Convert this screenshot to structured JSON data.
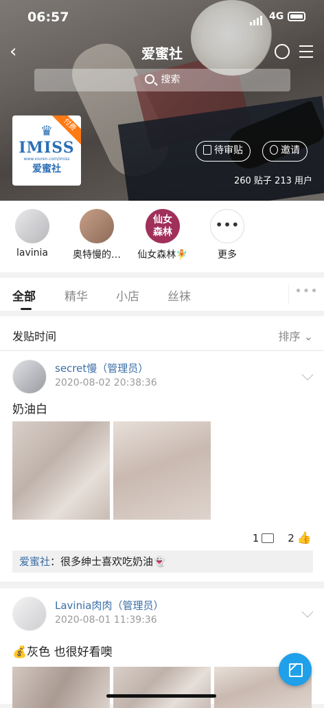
{
  "status_bar": {
    "time": "06:57",
    "network": "4G"
  },
  "header": {
    "title": "爱蜜社",
    "search_placeholder": "搜索"
  },
  "forum": {
    "logo_brand": "IMISS",
    "logo_url": "www.xiuren.com/imiss",
    "logo_cn": "爱蜜社",
    "paid_badge": "付费",
    "pending_label": "待审贴",
    "invite_label": "邀请",
    "stats": "260 贴子  213 用户"
  },
  "quick_links": [
    {
      "label": "lavinia"
    },
    {
      "label": "奥特慢的…"
    },
    {
      "label": "仙女森林🧚",
      "avatar_text": "仙女\n森林"
    },
    {
      "label": "更多"
    }
  ],
  "tabs": [
    {
      "label": "全部"
    },
    {
      "label": "精华"
    },
    {
      "label": "小店"
    },
    {
      "label": "丝袜"
    }
  ],
  "sort": {
    "left_label": "发贴时间",
    "right_label": "排序"
  },
  "posts": [
    {
      "author": "secret慢（管理员）",
      "time": "2020-08-02 20:38:36",
      "text": "奶油白",
      "comments": "1",
      "likes": "2",
      "reply_author": "爱蜜社",
      "reply_text": "：很多绅士喜欢吃奶油👻"
    },
    {
      "author": "Lavinia肉肉（管理员）",
      "time": "2020-08-01 11:39:36",
      "text": "💰灰色 也很好看噢"
    }
  ],
  "colors": {
    "link": "#3a6ea5",
    "fab": "#1fa0e8",
    "paid_badge": "#ff7a14",
    "like": "#2e86de"
  }
}
